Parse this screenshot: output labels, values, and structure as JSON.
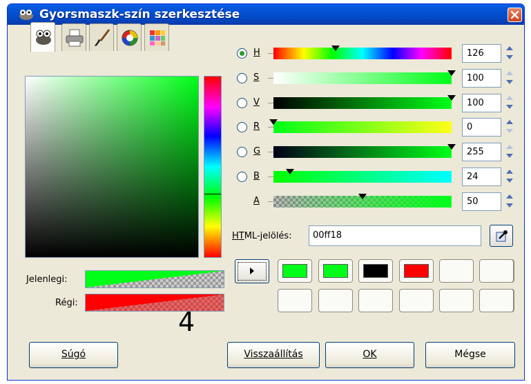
{
  "window": {
    "title": "Gyorsmaszk-szín szerkesztése",
    "icon": "gimp-wilber-icon",
    "close_icon": "close-icon"
  },
  "tabs": [
    {
      "name": "gimp-selector-tab",
      "icon": "wilber-icon",
      "active": true
    },
    {
      "name": "cmyk-tab",
      "icon": "printer-icon",
      "active": false
    },
    {
      "name": "watercolor-tab",
      "icon": "paintbrush-icon",
      "active": false
    },
    {
      "name": "wheel-tab",
      "icon": "color-wheel-icon",
      "active": false
    },
    {
      "name": "palette-tab",
      "icon": "palette-icon",
      "active": false
    }
  ],
  "selector": {
    "current_color": "#00ff18",
    "hue_position": 0.35
  },
  "labels": {
    "current": "Jelenlegi:",
    "previous": "Régi:"
  },
  "current_color": "#00ff18",
  "previous_color": "#ff0000",
  "overlay_number": "4",
  "channels": [
    {
      "key": "h",
      "label": "H",
      "value": "126",
      "selected": true,
      "marker": 0.35
    },
    {
      "key": "s",
      "label": "S",
      "value": "100",
      "selected": false,
      "marker": 1.0
    },
    {
      "key": "v",
      "label": "V",
      "value": "100",
      "selected": false,
      "marker": 1.0
    },
    {
      "key": "r",
      "label": "R",
      "value": "0",
      "selected": false,
      "marker": 0.0
    },
    {
      "key": "g",
      "label": "G",
      "value": "255",
      "selected": false,
      "marker": 1.0
    },
    {
      "key": "b",
      "label": "B",
      "value": "24",
      "selected": false,
      "marker": 0.094
    },
    {
      "key": "a",
      "label": "A",
      "value": "50",
      "selected": false,
      "marker": 0.5
    }
  ],
  "html_notation": {
    "label": "HTML-jelölés:",
    "value": "00ff18"
  },
  "history": {
    "colors": [
      "#00ff18",
      "#00ff18",
      "#000000",
      "#ff0000",
      "",
      "",
      "",
      "",
      "",
      "",
      "",
      "",
      ""
    ]
  },
  "buttons": {
    "help": "Súgó",
    "reset": "Visszaállítás",
    "ok": "OK",
    "cancel": "Mégse"
  }
}
